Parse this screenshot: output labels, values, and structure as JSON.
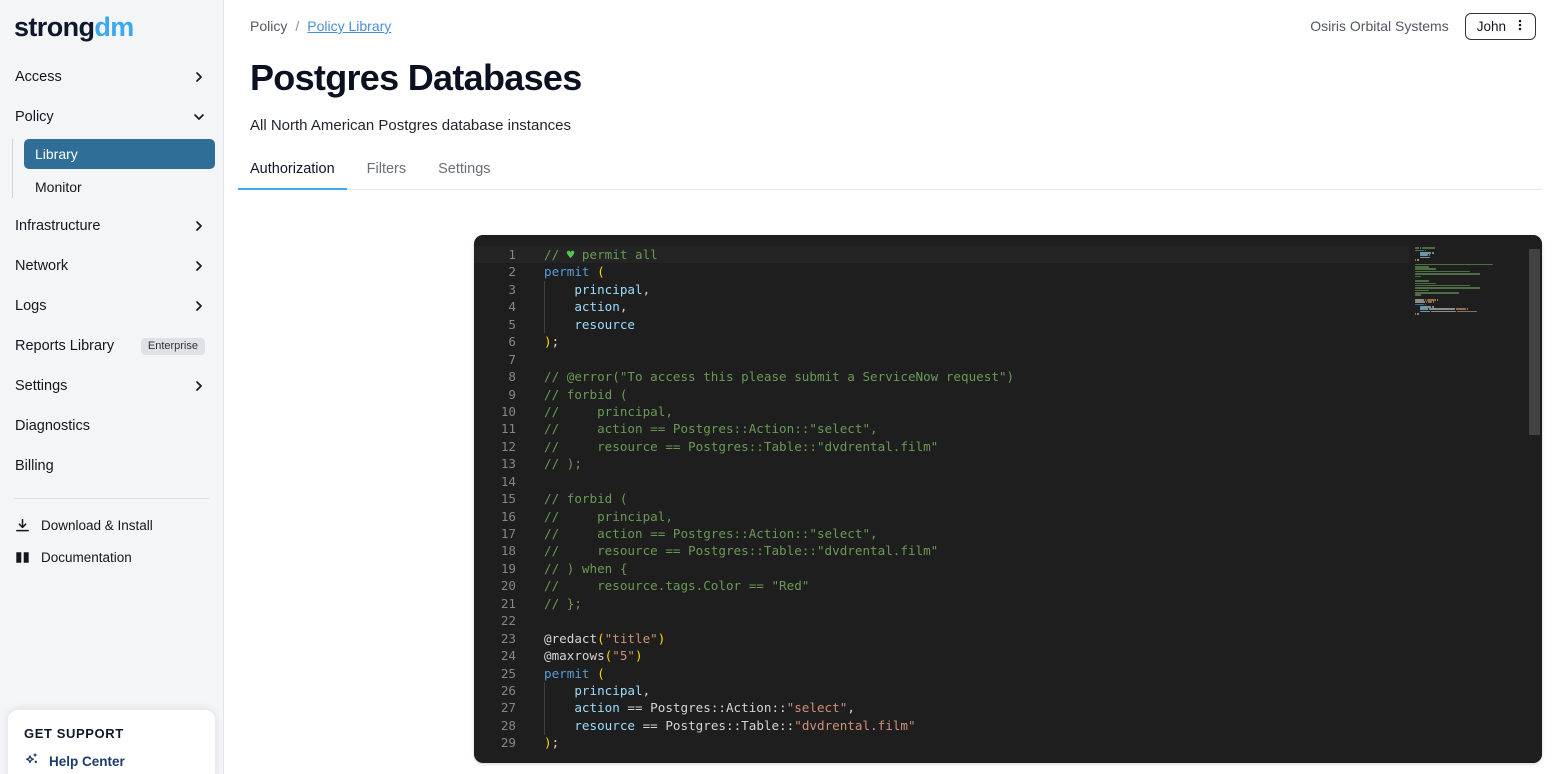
{
  "brand": {
    "name_dark": "strong",
    "name_light": "dm"
  },
  "sidebar": {
    "nav": [
      {
        "label": "Access",
        "icon": "chevron-right-icon",
        "expanded": false
      },
      {
        "label": "Policy",
        "icon": "chevron-down-icon",
        "expanded": true
      },
      {
        "label": "Infrastructure",
        "icon": "chevron-right-icon",
        "expanded": false
      },
      {
        "label": "Network",
        "icon": "chevron-right-icon",
        "expanded": false
      },
      {
        "label": "Logs",
        "icon": "chevron-right-icon",
        "expanded": false
      },
      {
        "label": "Reports Library",
        "badge": "Enterprise"
      },
      {
        "label": "Settings",
        "icon": "chevron-right-icon",
        "expanded": false
      },
      {
        "label": "Diagnostics"
      },
      {
        "label": "Billing"
      }
    ],
    "policy_subitems": [
      {
        "label": "Library",
        "active": true
      },
      {
        "label": "Monitor",
        "active": false
      }
    ],
    "utilities": [
      {
        "label": "Download & Install",
        "icon": "download-icon"
      },
      {
        "label": "Documentation",
        "icon": "book-icon"
      }
    ],
    "support": {
      "title": "GET SUPPORT",
      "link_label": "Help Center",
      "icon": "sparkle-icon"
    },
    "active_color": "#2f6e96"
  },
  "topbar": {
    "breadcrumb": {
      "root": "Policy",
      "separator": "/",
      "current": "Policy Library"
    },
    "org": "Osiris Orbital Systems",
    "user": {
      "name": "John",
      "icon": "kebab-menu-icon"
    }
  },
  "page": {
    "title": "Postgres Databases",
    "subtitle": "All North American Postgres database instances",
    "tabs": [
      {
        "label": "Authorization",
        "active": true
      },
      {
        "label": "Filters",
        "active": false
      },
      {
        "label": "Settings",
        "active": false
      }
    ],
    "accent_color": "#3aa9f0"
  },
  "editor": {
    "theme_bg": "#1e1e1e",
    "gutter_color": "#868686",
    "current_line": 1,
    "first_visible_line": 1,
    "last_visible_line": 29,
    "total_lines_hint": 30,
    "lines": [
      {
        "n": 1,
        "tokens": [
          {
            "t": "// ",
            "c": "cmt"
          },
          {
            "t": "♥",
            "c": "heart"
          },
          {
            "t": " permit all",
            "c": "cmt"
          }
        ]
      },
      {
        "n": 2,
        "tokens": [
          {
            "t": "permit ",
            "c": "kw"
          },
          {
            "t": "(",
            "c": "pun"
          }
        ]
      },
      {
        "n": 3,
        "tokens": [
          {
            "t": "    principal",
            "c": "var"
          },
          {
            "t": ",",
            "c": "pln"
          }
        ]
      },
      {
        "n": 4,
        "tokens": [
          {
            "t": "    action",
            "c": "var"
          },
          {
            "t": ",",
            "c": "pln"
          }
        ]
      },
      {
        "n": 5,
        "tokens": [
          {
            "t": "    resource",
            "c": "var"
          }
        ]
      },
      {
        "n": 6,
        "tokens": [
          {
            "t": ")",
            "c": "pun"
          },
          {
            "t": ";",
            "c": "pln"
          }
        ]
      },
      {
        "n": 7,
        "tokens": []
      },
      {
        "n": 8,
        "tokens": [
          {
            "t": "// @error(\"To access this please submit a ServiceNow request\")",
            "c": "cmt"
          }
        ]
      },
      {
        "n": 9,
        "tokens": [
          {
            "t": "// forbid (",
            "c": "cmt"
          }
        ]
      },
      {
        "n": 10,
        "tokens": [
          {
            "t": "//     principal,",
            "c": "cmt"
          }
        ]
      },
      {
        "n": 11,
        "tokens": [
          {
            "t": "//     action == Postgres::Action::\"select\",",
            "c": "cmt"
          }
        ]
      },
      {
        "n": 12,
        "tokens": [
          {
            "t": "//     resource == Postgres::Table::\"dvdrental.film\"",
            "c": "cmt"
          }
        ]
      },
      {
        "n": 13,
        "tokens": [
          {
            "t": "// );",
            "c": "cmt"
          }
        ]
      },
      {
        "n": 14,
        "tokens": []
      },
      {
        "n": 15,
        "tokens": [
          {
            "t": "// forbid (",
            "c": "cmt"
          }
        ]
      },
      {
        "n": 16,
        "tokens": [
          {
            "t": "//     principal,",
            "c": "cmt"
          }
        ]
      },
      {
        "n": 17,
        "tokens": [
          {
            "t": "//     action == Postgres::Action::\"select\",",
            "c": "cmt"
          }
        ]
      },
      {
        "n": 18,
        "tokens": [
          {
            "t": "//     resource == Postgres::Table::\"dvdrental.film\"",
            "c": "cmt"
          }
        ]
      },
      {
        "n": 19,
        "tokens": [
          {
            "t": "// ) when {",
            "c": "cmt"
          }
        ]
      },
      {
        "n": 20,
        "tokens": [
          {
            "t": "//     resource.tags.Color == \"Red\"",
            "c": "cmt"
          }
        ]
      },
      {
        "n": 21,
        "tokens": [
          {
            "t": "// };",
            "c": "cmt"
          }
        ]
      },
      {
        "n": 22,
        "tokens": []
      },
      {
        "n": 23,
        "tokens": [
          {
            "t": "@redact",
            "c": "pln"
          },
          {
            "t": "(",
            "c": "pun"
          },
          {
            "t": "\"title\"",
            "c": "str"
          },
          {
            "t": ")",
            "c": "pun"
          }
        ]
      },
      {
        "n": 24,
        "tokens": [
          {
            "t": "@maxrows",
            "c": "pln"
          },
          {
            "t": "(",
            "c": "pun"
          },
          {
            "t": "\"5\"",
            "c": "str"
          },
          {
            "t": ")",
            "c": "pun"
          }
        ]
      },
      {
        "n": 25,
        "tokens": [
          {
            "t": "permit ",
            "c": "kw"
          },
          {
            "t": "(",
            "c": "pun"
          }
        ]
      },
      {
        "n": 26,
        "tokens": [
          {
            "t": "    principal",
            "c": "var"
          },
          {
            "t": ",",
            "c": "pln"
          }
        ]
      },
      {
        "n": 27,
        "tokens": [
          {
            "t": "    action",
            "c": "var"
          },
          {
            "t": " == Postgres::Action::",
            "c": "pln"
          },
          {
            "t": "\"select\"",
            "c": "str"
          },
          {
            "t": ",",
            "c": "pln"
          }
        ]
      },
      {
        "n": 28,
        "tokens": [
          {
            "t": "    resource",
            "c": "var"
          },
          {
            "t": " == Postgres::Table::",
            "c": "pln"
          },
          {
            "t": "\"dvdrental.film\"",
            "c": "str"
          }
        ]
      },
      {
        "n": 29,
        "tokens": [
          {
            "t": ")",
            "c": "pun"
          },
          {
            "t": ";",
            "c": "pln"
          }
        ]
      }
    ],
    "colors": {
      "comment": "#6a9955",
      "keyword": "#569cd6",
      "variable": "#9cdcfe",
      "string": "#ce9178",
      "punctuation": "#ffd700",
      "plain": "#d4d4d4"
    },
    "scrollbar": {
      "thumb_top_pct": 3,
      "thumb_height_pct": 35
    }
  }
}
